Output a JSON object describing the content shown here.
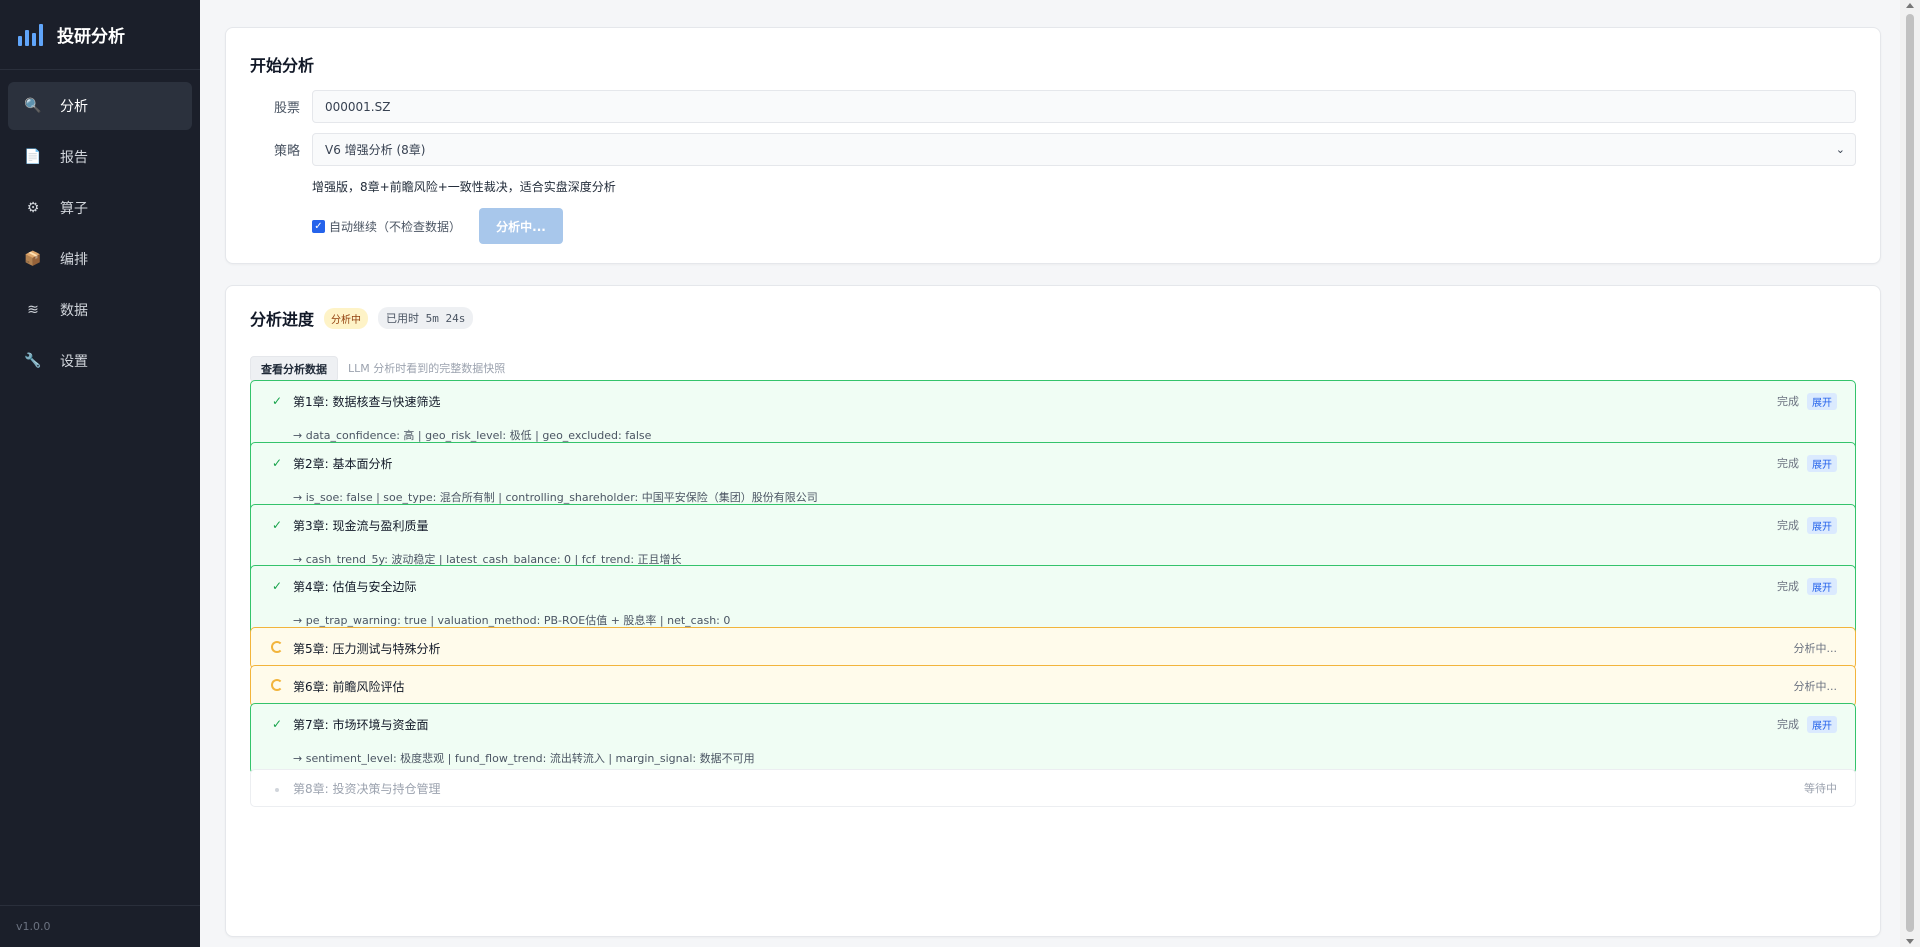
{
  "sidebar": {
    "brand": "投研分析",
    "items": [
      {
        "label": "分析",
        "icon": "search-icon",
        "glyph": "🔍",
        "active": true
      },
      {
        "label": "报告",
        "icon": "document-icon",
        "glyph": "📄",
        "active": false
      },
      {
        "label": "算子",
        "icon": "gear-icon",
        "glyph": "⚙",
        "active": false
      },
      {
        "label": "编排",
        "icon": "package-icon",
        "glyph": "📦",
        "active": false
      },
      {
        "label": "数据",
        "icon": "database-icon",
        "glyph": "≋",
        "active": false
      },
      {
        "label": "设置",
        "icon": "wrench-icon",
        "glyph": "🔧",
        "active": false
      }
    ],
    "version": "v1.0.0"
  },
  "start": {
    "title": "开始分析",
    "stock_label": "股票",
    "stock_value": "000001.SZ",
    "strategy_label": "策略",
    "strategy_value": "V6 增强分析 (8章)",
    "strategy_desc": "增强版，8章+前瞻风险+一致性裁决，适合实盘深度分析",
    "auto_continue_label": "自动继续（不检查数据）",
    "auto_continue_checked": true,
    "submit_label": "分析中..."
  },
  "progress": {
    "title": "分析进度",
    "status_badge": "分析中",
    "elapsed": "已用时 5m 24s",
    "view_data_label": "查看分析数据",
    "view_data_hint": "LLM 分析时看到的完整数据快照",
    "status_colors": {
      "done": "#34c36b",
      "running": "#f2b43c",
      "waiting": "#eceef1"
    },
    "chapters": [
      {
        "title": "第1章: 数据核查与快速筛选",
        "state": "done",
        "status": "完成",
        "expand": "展开",
        "summary": "→  data_confidence: 高 | geo_risk_level: 极低 | geo_excluded: false"
      },
      {
        "title": "第2章: 基本面分析",
        "state": "done",
        "status": "完成",
        "expand": "展开",
        "summary": "→  is_soe: false | soe_type: 混合所有制 | controlling_shareholder: 中国平安保险（集团）股份有限公司"
      },
      {
        "title": "第3章: 现金流与盈利质量",
        "state": "done",
        "status": "完成",
        "expand": "展开",
        "summary": "→  cash_trend_5y: 波动稳定 | latest_cash_balance: 0 | fcf_trend: 正且增长"
      },
      {
        "title": "第4章: 估值与安全边际",
        "state": "done",
        "status": "完成",
        "expand": "展开",
        "summary": "→  pe_trap_warning: true | valuation_method: PB-ROE估值 + 股息率 | net_cash: 0"
      },
      {
        "title": "第5章: 压力测试与特殊分析",
        "state": "running",
        "status": "分析中..."
      },
      {
        "title": "第6章: 前瞻风险评估",
        "state": "running",
        "status": "分析中..."
      },
      {
        "title": "第7章: 市场环境与资金面",
        "state": "done",
        "status": "完成",
        "expand": "展开",
        "summary": "→  sentiment_level: 极度悲观 | fund_flow_trend: 流出转流入 | margin_signal: 数据不可用"
      },
      {
        "title": "第8章: 投资决策与持仓管理",
        "state": "waiting",
        "status": "等待中"
      }
    ]
  }
}
